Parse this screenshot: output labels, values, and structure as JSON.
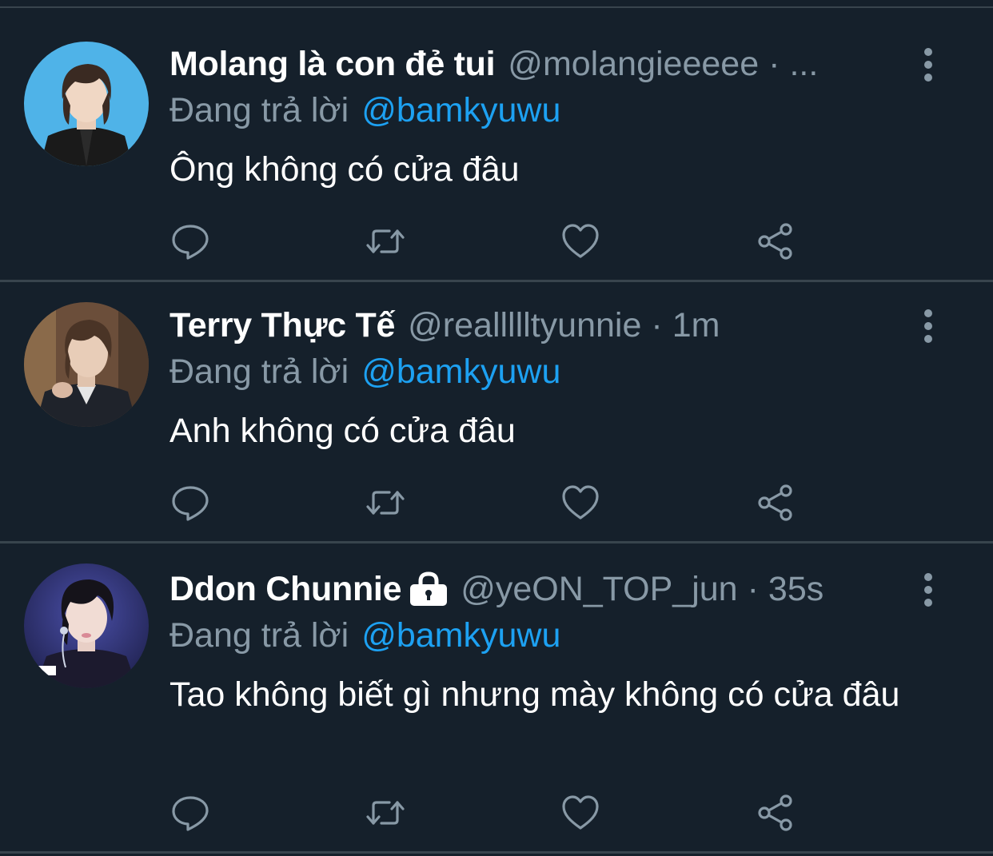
{
  "tweets": [
    {
      "display_name": "Molang là con đẻ tui",
      "handle": "@molangieeeee",
      "separator": "·",
      "time": "...",
      "locked": false,
      "reply_prefix": "Đang trả lời",
      "reply_to": "@bamkyuwu",
      "text": "Ông không có cửa đâu",
      "avatar_colors": {
        "bg": "#4fb3e8",
        "skin": "#f0d7c4",
        "hair": "#3a2a22",
        "jacket": "#1a1a1a"
      }
    },
    {
      "display_name": "Terry Thực Tế",
      "handle": "@reallllltyunnie",
      "separator": "·",
      "time": "1m",
      "locked": false,
      "reply_prefix": "Đang trả lời",
      "reply_to": "@bamkyuwu",
      "text": "Anh không có cửa đâu",
      "avatar_colors": {
        "bg": "#6b4e3a",
        "skin": "#e8cdb8",
        "hair": "#4a3426",
        "jacket": "#1f232b"
      }
    },
    {
      "display_name": "Ddon Chunnie",
      "handle": "@yeON_TOP_jun",
      "separator": "·",
      "time": "35s",
      "locked": true,
      "reply_prefix": "Đang trả lời",
      "reply_to": "@bamkyuwu",
      "text": "Tao không biết gì nhưng mày không có cửa đâu",
      "avatar_colors": {
        "bg": "#2a2f6b",
        "skin": "#f1dcd4",
        "hair": "#15131a",
        "jacket": "#1c1a2e"
      }
    }
  ],
  "actions": [
    "reply-icon",
    "retweet-icon",
    "like-icon",
    "share-icon"
  ],
  "theme": {
    "background": "#15202b",
    "divider": "#38444d",
    "secondary_text": "#8899a6",
    "accent": "#1da1f2",
    "icon": "#8899a6"
  }
}
